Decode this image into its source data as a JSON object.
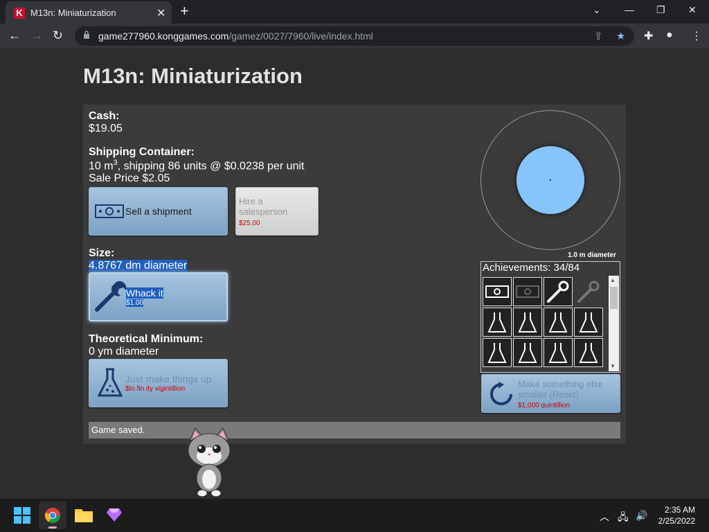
{
  "browser": {
    "tab_title": "M13n: Miniaturization",
    "favicon_letter": "K",
    "url_host": "game277960.konggames.com",
    "url_path": "/gamez/0027/7960/live/index.html"
  },
  "game": {
    "title": "M13n: Miniaturization",
    "cash_label": "Cash:",
    "cash_value": "$19.05",
    "shipping_label": "Shipping Container:",
    "shipping_size": "10 m",
    "shipping_exp": "3",
    "shipping_detail": ", shipping 86 units @ $0.0238 per unit",
    "sale_price": "Sale Price $2.05",
    "sell_button": "Sell a shipment",
    "hire_button": "Hire a salesperson",
    "hire_price": "$25.00",
    "size_label": "Size:",
    "size_value": "4.8767 dm diameter",
    "whack_button": "Whack it",
    "whack_price": "$1.00",
    "theory_label": "Theoretical Minimum:",
    "theory_value": "0 ym diameter",
    "make_button": "Just make things up",
    "make_price": "$In fin ity vigintillion",
    "diameter_caption": "1.0 m diameter",
    "achievements_label": "Achievements: 34/84",
    "reset_button": "Make something else smaller (Reset)",
    "reset_price": "$1,000 quintillion",
    "status": "Game saved."
  },
  "taskbar": {
    "time": "2:35 AM",
    "date": "2/25/2022"
  },
  "colors": {
    "button_blue": "#a7c4e0",
    "circle": "#86c5fb",
    "price_red": "#cc0000"
  }
}
